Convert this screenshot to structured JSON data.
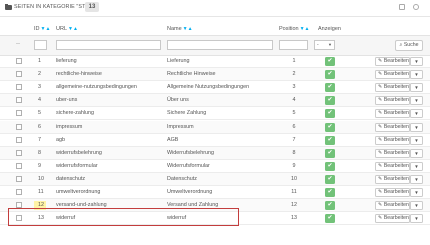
{
  "header": {
    "title": "SEITEN IN KATEGORIE \"START\"",
    "count": "13"
  },
  "columns": {
    "id": "ID",
    "url": "URL",
    "name": "Name",
    "position": "Position",
    "display": "Anzeigen"
  },
  "filter": {
    "dash": "--",
    "select_value": "-",
    "search_label": "Suche"
  },
  "actions": {
    "edit_label": "Bearbeiten"
  },
  "colors": {
    "accent": "#00aff0",
    "check": "#72c279",
    "highlight_border": "#c33d3d",
    "highlight_id": "#fff3a6"
  },
  "rows": [
    {
      "id": "1",
      "url": "lieferung",
      "name": "Lieferung",
      "position": "1"
    },
    {
      "id": "2",
      "url": "rechtliche-hinweise",
      "name": "Rechtliche Hinweise",
      "position": "2"
    },
    {
      "id": "3",
      "url": "allgemeine-nutzungsbedingungen",
      "name": "Allgemeine Nutzungsbedingungen",
      "position": "3"
    },
    {
      "id": "4",
      "url": "uber-uns",
      "name": "Über uns",
      "position": "4"
    },
    {
      "id": "5",
      "url": "sichere-zahlung",
      "name": "Sichere Zahlung",
      "position": "5"
    },
    {
      "id": "6",
      "url": "impressum",
      "name": "Impressum",
      "position": "6"
    },
    {
      "id": "7",
      "url": "agb",
      "name": "AGB",
      "position": "7"
    },
    {
      "id": "8",
      "url": "widerrufsbelehrung",
      "name": "Widerrufsbelehrung",
      "position": "8"
    },
    {
      "id": "9",
      "url": "widerrufsformular",
      "name": "Widerrufsformular",
      "position": "9"
    },
    {
      "id": "10",
      "url": "datenschutz",
      "name": "Datenschutz",
      "position": "10"
    },
    {
      "id": "11",
      "url": "umweltverordnung",
      "name": "Umweltverordnung",
      "position": "11"
    },
    {
      "id": "12",
      "url": "versand-und-zahlung",
      "name": "Versand und Zahlung",
      "position": "12"
    },
    {
      "id": "13",
      "url": "widerruf",
      "name": "widerruf",
      "position": "13"
    }
  ]
}
